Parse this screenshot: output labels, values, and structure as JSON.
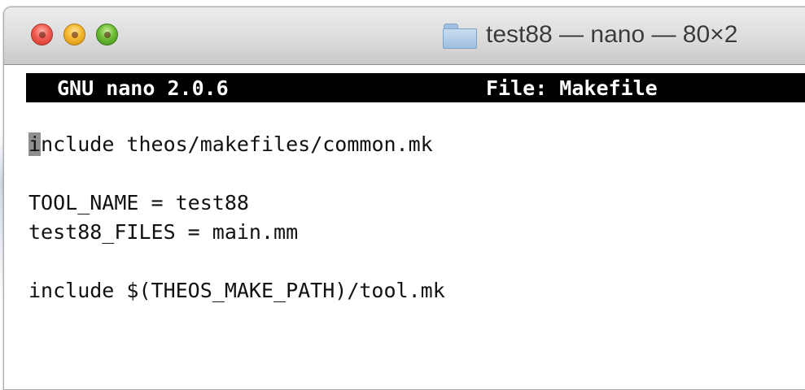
{
  "window": {
    "title": "test88 — nano — 80×2"
  },
  "nano": {
    "version": "GNU nano 2.0.6",
    "file_label": "File: Makefile"
  },
  "editor": {
    "cursor_char": "i",
    "line1_rest": "nclude theos/makefiles/common.mk",
    "line2": "",
    "line3": "TOOL_NAME = test88",
    "line4": "test88_FILES = main.mm",
    "line5": "",
    "line6": "include $(THEOS_MAKE_PATH)/tool.mk"
  },
  "colors": {
    "close": "#f15a4f",
    "minimize": "#f5b82e",
    "zoom": "#6ebd35",
    "nano_header_bg": "#000000",
    "cursor": "#8f8f8f"
  },
  "icons": {
    "title_icon": "folder-icon"
  }
}
